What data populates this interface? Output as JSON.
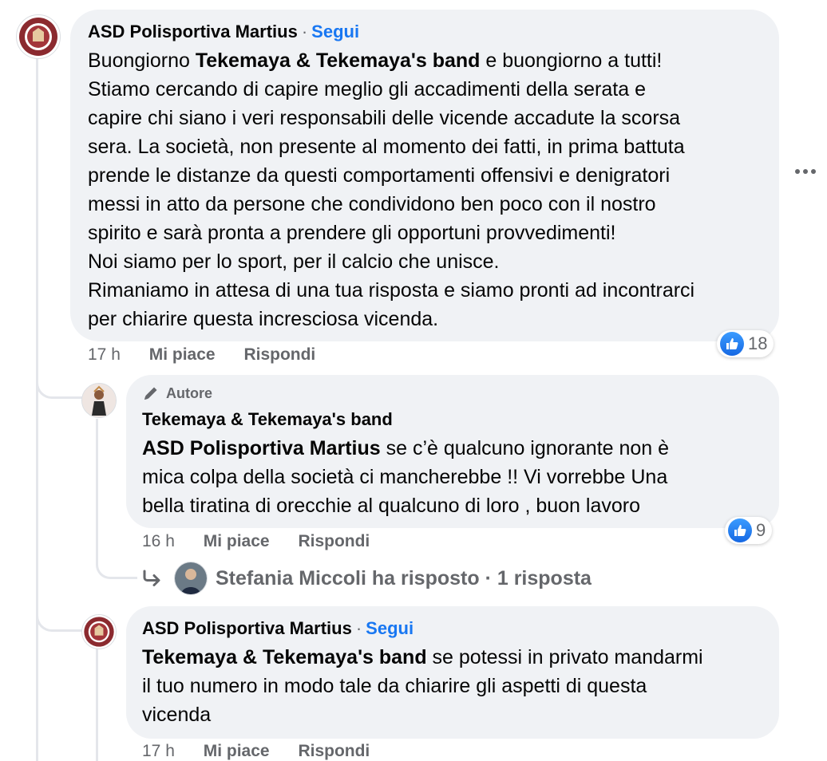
{
  "comments": [
    {
      "author": "ASD Polisportiva Martius",
      "follow_label": "Segui",
      "lines": [
        {
          "b": "",
          "t": "Buongiorno "
        },
        {
          "b": "Tekemaya & Tekemaya's band",
          "t": " e buongiorno a tutti!"
        },
        {
          "b": "",
          "t": "Stiamo cercando di capire meglio gli accadimenti della serata e"
        },
        {
          "b": "",
          "t": "capire chi siano i veri responsabili delle vicende accadute la scorsa"
        },
        {
          "b": "",
          "t": "sera. La società, non presente al momento dei fatti, in prima battuta"
        },
        {
          "b": "",
          "t": "prende le distanze da questi comportamenti offensivi e denigratori"
        },
        {
          "b": "",
          "t": "messi in atto da persone che condividono ben poco con il nostro"
        },
        {
          "b": "",
          "t": "spirito e sarà pronta a prendere gli opportuni provvedimenti!"
        },
        {
          "b": "",
          "t": "Noi siamo per lo sport, per il calcio che unisce."
        },
        {
          "b": "",
          "t": "Rimaniamo in attesa di una tua risposta e siamo pronti ad incontrarci"
        },
        {
          "b": "",
          "t": "per chiarire questa incresciosa vicenda."
        }
      ],
      "time": "17 h",
      "like_label": "Mi piace",
      "reply_label": "Rispondi",
      "reactions": "18"
    },
    {
      "author_badge": "Autore",
      "author": "Tekemaya & Tekemaya's band",
      "lines": [
        {
          "b": "ASD Polisportiva Martius",
          "t": " se c’è qualcuno ignorante non è"
        },
        {
          "b": "",
          "t": "mica colpa della società ci mancherebbe !! Vi vorrebbe Una"
        },
        {
          "b": "",
          "t": "bella tiratina di orecchie al qualcuno di loro , buon lavoro"
        }
      ],
      "time": "16 h",
      "like_label": "Mi piace",
      "reply_label": "Rispondi",
      "reactions": "9",
      "replies_summary": "Stefania Miccoli ha risposto · 1 risposta"
    },
    {
      "author": "ASD Polisportiva Martius",
      "follow_label": "Segui",
      "lines": [
        {
          "b": "Tekemaya & Tekemaya's band",
          "t": " se potessi in privato mandarmi"
        },
        {
          "b": "",
          "t": "il tuo numero in modo tale da chiarire gli aspetti di questa"
        },
        {
          "b": "",
          "t": "vicenda"
        }
      ],
      "time": "17 h",
      "like_label": "Mi piace",
      "reply_label": "Rispondi"
    }
  ],
  "dot_separator": "·",
  "icons": {
    "more": "more-options-icon",
    "like": "like-thumb-icon",
    "pencil": "pencil-icon",
    "reply_arrow": "reply-arrow-icon"
  },
  "colors": {
    "link_blue": "#1877f2",
    "bubble": "#f0f2f5",
    "secondary_text": "#65676b",
    "club_maroon": "#8b2a2f"
  }
}
